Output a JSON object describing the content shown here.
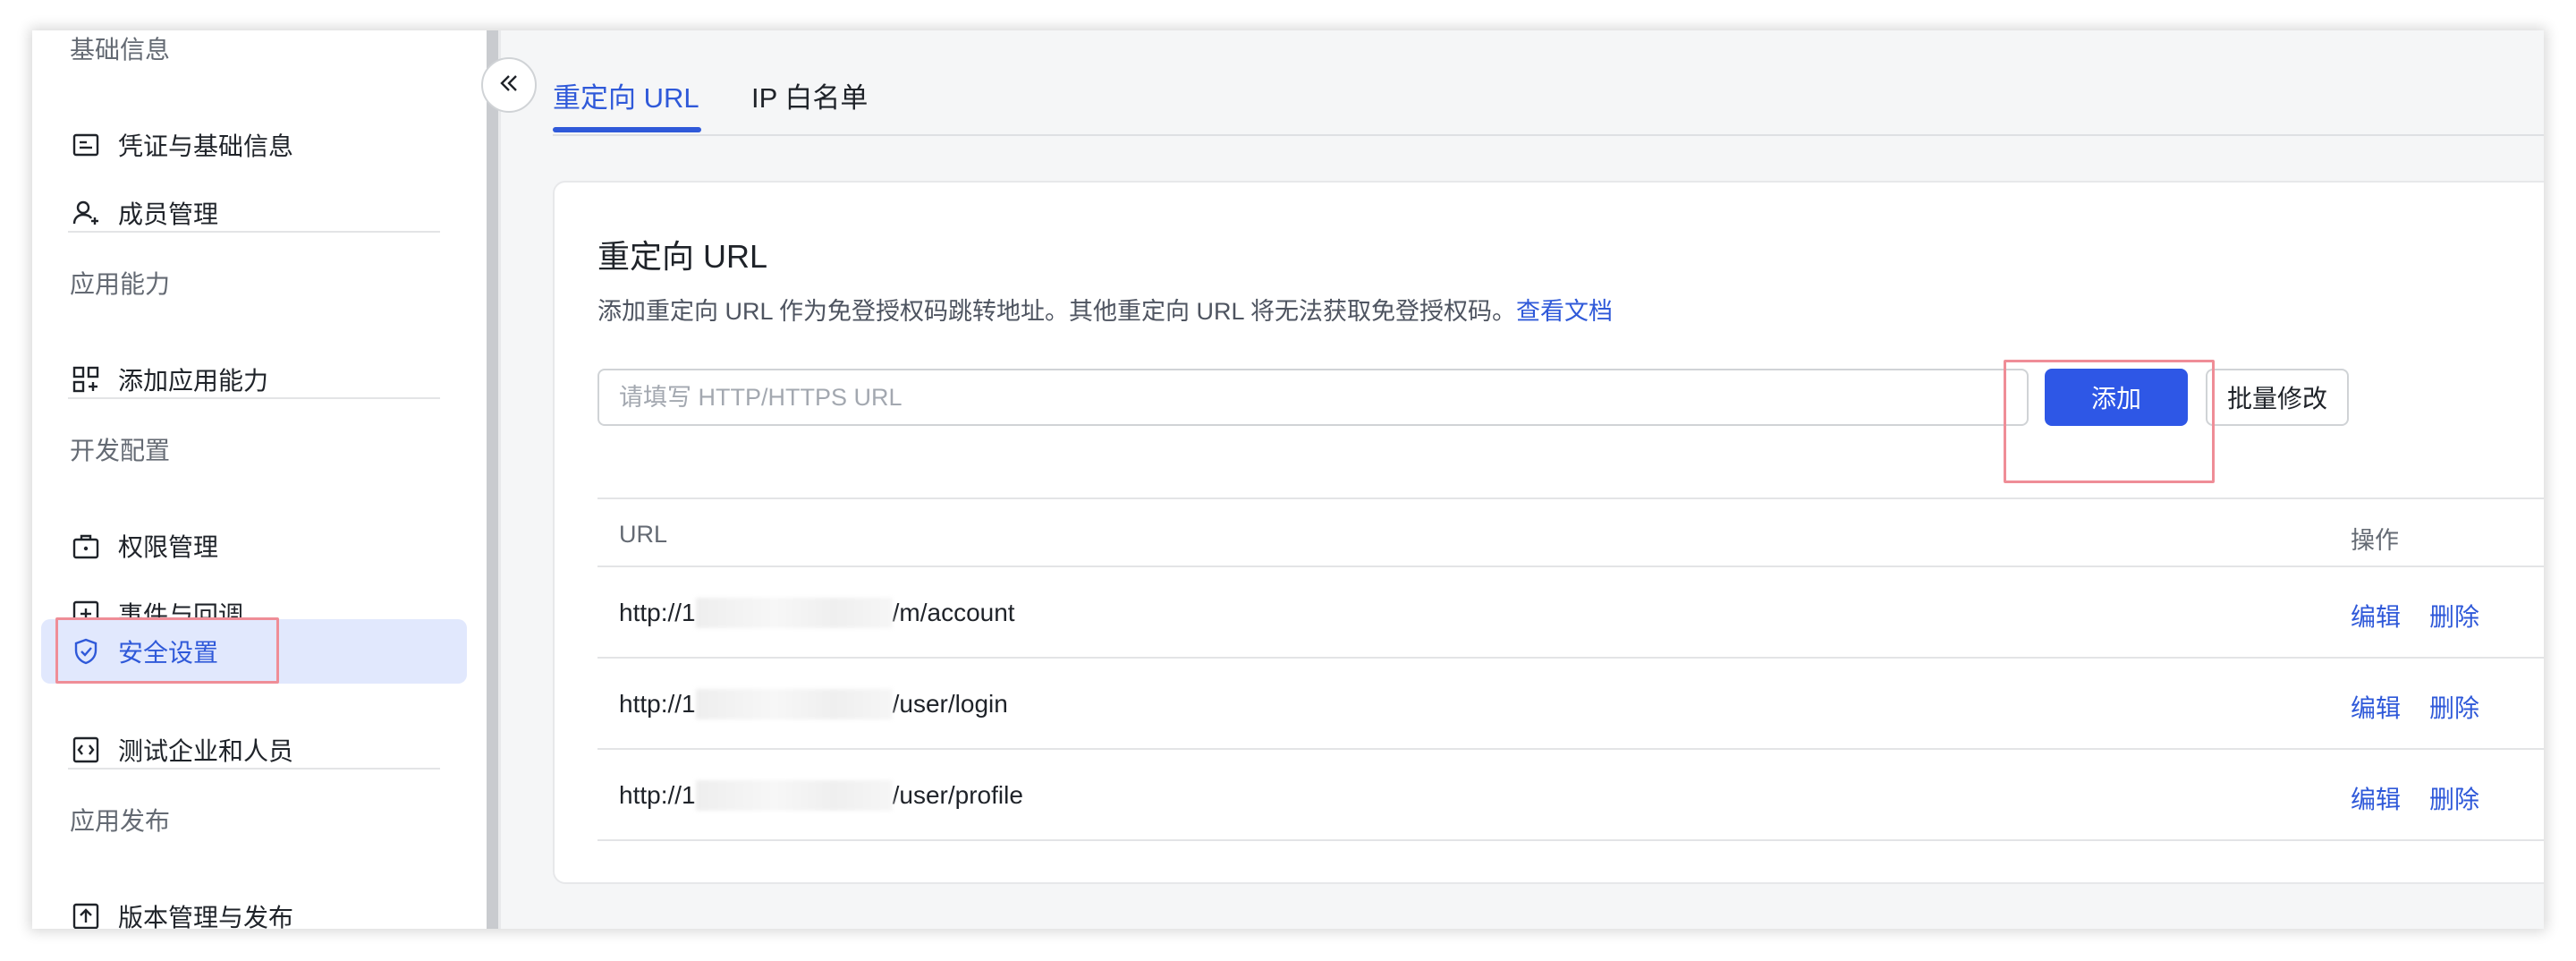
{
  "sidebar": {
    "groups": [
      {
        "title": "基础信息"
      },
      {
        "title": "应用能力"
      },
      {
        "title": "开发配置"
      },
      {
        "title": "应用发布"
      }
    ],
    "items": [
      {
        "label": "凭证与基础信息",
        "icon": "credential-icon"
      },
      {
        "label": "成员管理",
        "icon": "member-add-icon"
      },
      {
        "label": "添加应用能力",
        "icon": "apps-add-icon"
      },
      {
        "label": "权限管理",
        "icon": "permission-icon"
      },
      {
        "label": "事件与回调",
        "icon": "event-add-icon"
      },
      {
        "label": "安全设置",
        "icon": "shield-check-icon",
        "active": true
      },
      {
        "label": "测试企业和人员",
        "icon": "code-test-icon"
      },
      {
        "label": "版本管理与发布",
        "icon": "upload-icon"
      }
    ]
  },
  "tabs": [
    {
      "label": "重定向 URL",
      "active": true
    },
    {
      "label": "IP 白名单",
      "active": false
    }
  ],
  "card": {
    "title": "重定向 URL",
    "description": "添加重定向 URL 作为免登授权码跳转地址。其他重定向 URL 将无法获取免登授权码。",
    "doc_link": "查看文档",
    "input_placeholder": "请填写 HTTP/HTTPS URL",
    "add_button": "添加",
    "batch_button": "批量修改"
  },
  "table": {
    "headers": {
      "url": "URL",
      "actions": "操作"
    },
    "rows": [
      {
        "prefix": "http://1",
        "suffix": "/m/account"
      },
      {
        "prefix": "http://1",
        "suffix": "/user/login"
      },
      {
        "prefix": "http://1",
        "suffix": "/user/profile"
      }
    ],
    "edit_label": "编辑",
    "delete_label": "删除"
  },
  "colors": {
    "accent": "#2f59d9",
    "primary_button": "#2e57e6",
    "highlight": "#ef8d97",
    "active_bg": "#e1e8fd"
  }
}
